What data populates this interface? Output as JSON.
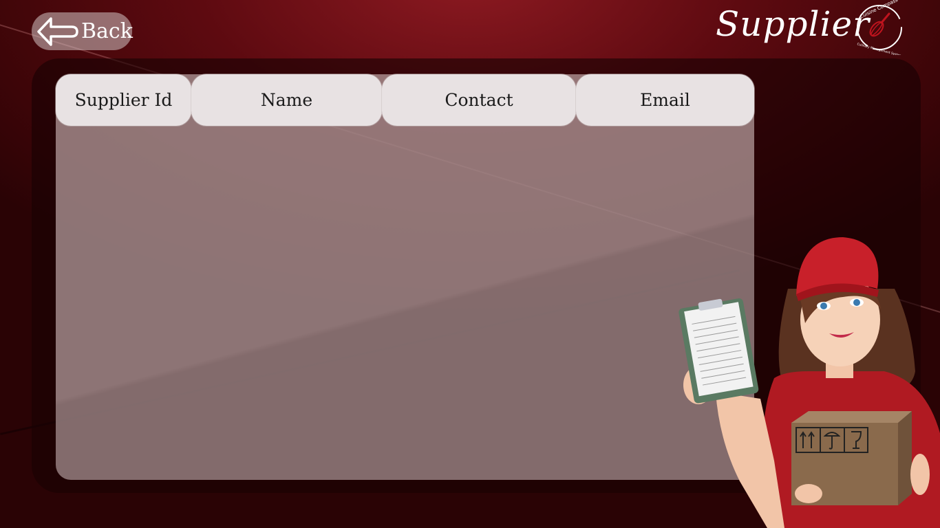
{
  "header": {
    "back_label": "Back",
    "title": "Supplier"
  },
  "logo": {
    "name": "Cuisine Compass",
    "tagline": "Culinary Management System"
  },
  "table": {
    "columns": [
      "Supplier Id",
      "Name",
      "Contact",
      "Email"
    ],
    "rows": []
  },
  "colors": {
    "background": "#5d0a10",
    "header_cell": "#e8e2e3",
    "accent": "#c0141e"
  },
  "icons": {
    "back": "left-arrow-icon",
    "logo": "whisk-icon"
  }
}
